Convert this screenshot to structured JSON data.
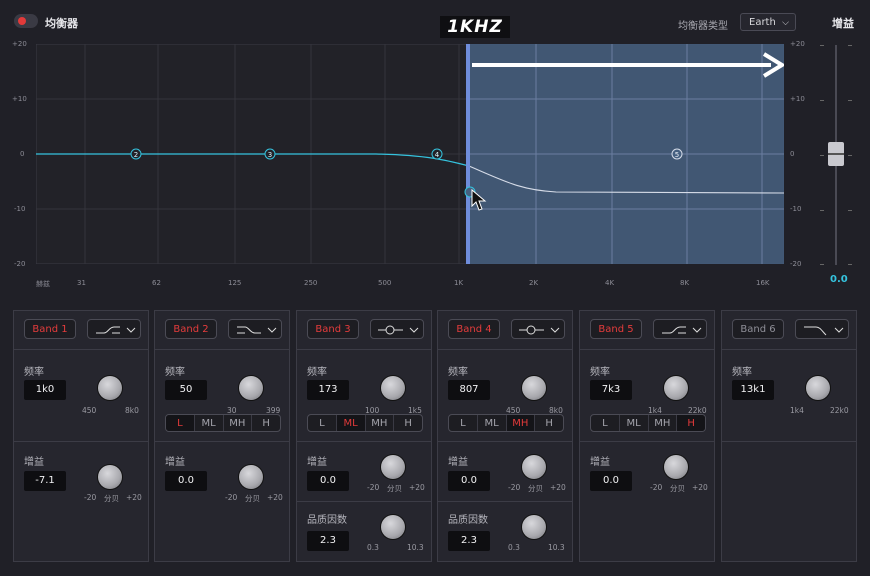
{
  "header": {
    "eq_title": "均衡器",
    "freq_banner": "1KHZ",
    "eq_type_label": "均衡器类型",
    "eq_type_value": "Earth",
    "gain_title": "增益"
  },
  "colors": {
    "accent": "#35c3de",
    "band_red": "#e23a3a",
    "selection": "#466080",
    "cursor_marker": "#6f8ddb"
  },
  "graph": {
    "y_labels_left": [
      "+20",
      "+10",
      "0",
      "-10",
      "-20"
    ],
    "y_labels_right": [
      "+20",
      "+10",
      "0",
      "-10",
      "-20"
    ],
    "x_labels": [
      "赫兹",
      "31",
      "62",
      "125",
      "250",
      "500",
      "1K",
      "2K",
      "4K",
      "8K",
      "16K"
    ],
    "nodes": [
      "2",
      "3",
      "4",
      "5"
    ],
    "selected_from": "1K",
    "arrow": "right"
  },
  "fader": {
    "value": "0.0"
  },
  "bands": [
    {
      "name": "Band 1",
      "enabled": true,
      "shape": "low-shelf",
      "freq_label": "频率",
      "freq": "1k0",
      "freq_min": "450",
      "freq_max": "8k0",
      "gain_label": "增益",
      "gain": "-7.1",
      "gain_min": "-20",
      "gain_unit": "分贝",
      "gain_max": "+20"
    },
    {
      "name": "Band 2",
      "enabled": true,
      "shape": "high-shelf",
      "freq_label": "频率",
      "freq": "50",
      "freq_min": "30",
      "freq_max": "399",
      "seg": [
        "L",
        "ML",
        "MH",
        "H"
      ],
      "seg_on": "L",
      "gain_label": "增益",
      "gain": "0.0",
      "gain_min": "-20",
      "gain_unit": "分贝",
      "gain_max": "+20"
    },
    {
      "name": "Band 3",
      "enabled": true,
      "shape": "bell",
      "freq_label": "频率",
      "freq": "173",
      "freq_min": "100",
      "freq_max": "1k5",
      "seg": [
        "L",
        "ML",
        "MH",
        "H"
      ],
      "seg_on": "ML",
      "gain_label": "增益",
      "gain": "0.0",
      "gain_min": "-20",
      "gain_unit": "分贝",
      "gain_max": "+20",
      "q_label": "品质因数",
      "q": "2.3",
      "q_min": "0.3",
      "q_max": "10.3"
    },
    {
      "name": "Band 4",
      "enabled": true,
      "shape": "bell",
      "freq_label": "频率",
      "freq": "807",
      "freq_min": "450",
      "freq_max": "8k0",
      "seg": [
        "L",
        "ML",
        "MH",
        "H"
      ],
      "seg_on": "MH",
      "gain_label": "增益",
      "gain": "0.0",
      "gain_min": "-20",
      "gain_unit": "分贝",
      "gain_max": "+20",
      "q_label": "品质因数",
      "q": "2.3",
      "q_min": "0.3",
      "q_max": "10.3"
    },
    {
      "name": "Band 5",
      "enabled": true,
      "shape": "low-shelf",
      "freq_label": "频率",
      "freq": "7k3",
      "freq_min": "1k4",
      "freq_max": "22k0",
      "seg": [
        "L",
        "ML",
        "MH",
        "H"
      ],
      "seg_on": "H",
      "gain_label": "增益",
      "gain": "0.0",
      "gain_min": "-20",
      "gain_unit": "分贝",
      "gain_max": "+20"
    },
    {
      "name": "Band 6",
      "enabled": false,
      "shape": "high-cut",
      "freq_label": "频率",
      "freq": "13k1",
      "freq_min": "1k4",
      "freq_max": "22k0"
    }
  ]
}
